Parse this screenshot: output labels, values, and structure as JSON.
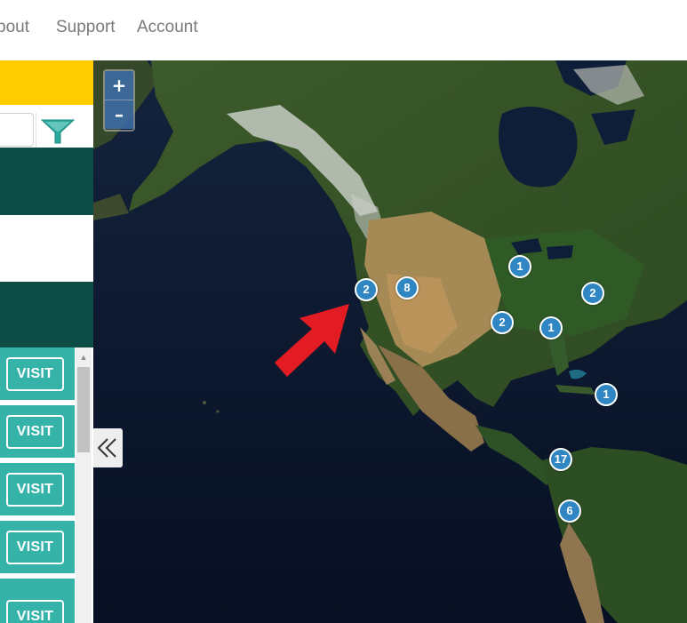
{
  "nav": {
    "links": [
      "bout",
      "Support",
      "Account"
    ]
  },
  "left_panel": {
    "search": {
      "value": "",
      "placeholder": ""
    },
    "filter_icon": "funnel-icon",
    "list": {
      "visit_label": "VISIT",
      "cards": [
        "VISIT",
        "VISIT",
        "VISIT",
        "VISIT",
        "VISIT"
      ]
    }
  },
  "map": {
    "zoom_in_label": "+",
    "zoom_out_label": "–",
    "collapse_icon": "double-chevron-left-icon",
    "markers": [
      "2",
      "8",
      "1",
      "2",
      "2",
      "1",
      "1",
      "17",
      "6"
    ]
  },
  "colors": {
    "accent_yellow": "#ffcc00",
    "dark_green": "#0e4d45",
    "teal": "#36b3a8",
    "marker_blue": "#2f86c2",
    "arrow_red": "#e31b23"
  }
}
